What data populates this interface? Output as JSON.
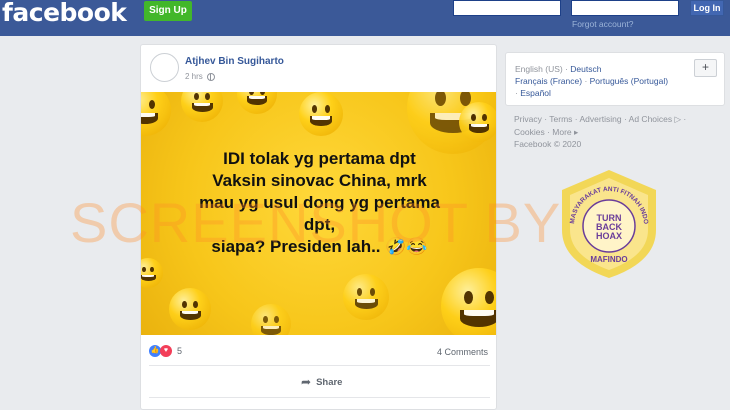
{
  "header": {
    "logo": "facebook",
    "signup_label": "Sign Up",
    "forgot_label": "Forgot account?",
    "login_label": "Log In",
    "email_value": "",
    "password_value": ""
  },
  "post": {
    "author": "Atjhev Bin Sugiharto",
    "time": "2 hrs",
    "image_text": [
      "IDI tolak yg pertama dpt",
      "Vaksin sinovac China, mrk",
      "mau yg usul dong yg pertama",
      "dpt,",
      "siapa? Presiden lah.. 🤣😂"
    ],
    "watermark": "SCREENSHOT BY",
    "reaction_count": "5",
    "comments_label": "4 Comments",
    "share_label": "Share"
  },
  "languages": {
    "current": "English (US)",
    "others": [
      "Deutsch",
      "Français (France)",
      "Português (Portugal)",
      "Español"
    ],
    "add_label": "+"
  },
  "footer": {
    "links": [
      "Privacy",
      "Terms",
      "Advertising",
      "Ad Choices",
      "Cookies",
      "More"
    ],
    "copyright": "Facebook © 2020"
  },
  "seal": {
    "ring_text": "MASYARAKAT ANTI FITNAH INDONESIA",
    "center_lines": [
      "TURN",
      "BACK",
      "HOAX"
    ],
    "bottom_text": "MAFINDO"
  },
  "colors": {
    "brand": "#3b5998",
    "signup": "#42b72a",
    "post_bg": "#f7c61a",
    "watermark": "#ff8c28",
    "seal": "#6a3d9a"
  }
}
